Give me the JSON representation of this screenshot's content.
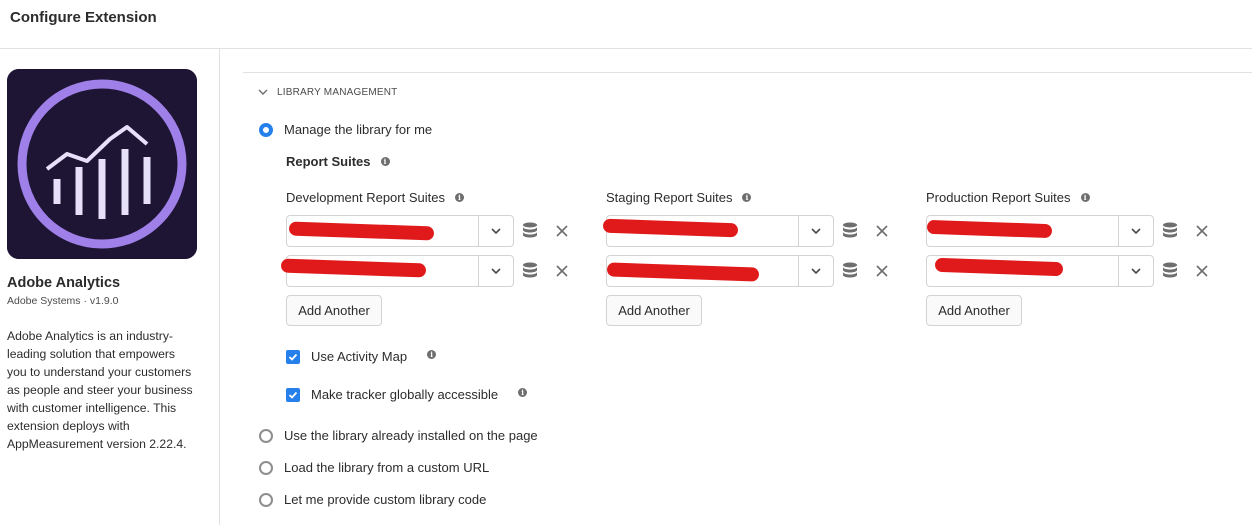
{
  "header": {
    "title": "Configure Extension"
  },
  "extension": {
    "name": "Adobe Analytics",
    "meta": "Adobe Systems · v1.9.0",
    "description": "Adobe Analytics is an industry-leading solution that empowers you to understand your customers as people and steer your business with customer intelligence. This extension deploys with AppMeasurement version 2.22.4.",
    "logo_icon": "adobe-analytics-logo",
    "logo_bg": "#1e1534",
    "logo_accent": "#9f7fe8"
  },
  "section": {
    "title": "LIBRARY MANAGEMENT",
    "expanded": true
  },
  "library_options": [
    {
      "label": "Manage the library for me",
      "checked": true
    },
    {
      "label": "Use the library already installed on the page",
      "checked": false
    },
    {
      "label": "Load the library from a custom URL",
      "checked": false
    },
    {
      "label": "Let me provide custom library code",
      "checked": false
    }
  ],
  "report_suites": {
    "label": "Report Suites",
    "columns": [
      {
        "label": "Development Report Suites",
        "values": [
          "",
          "",
          ""
        ],
        "add_label": "Add Another"
      },
      {
        "label": "Staging Report Suites",
        "values": [
          "",
          ""
        ],
        "add_label": "Add Another"
      },
      {
        "label": "Production Report Suites",
        "values": [
          "",
          ""
        ],
        "add_label": "Add Another"
      }
    ]
  },
  "options": {
    "activity_map": {
      "label": "Use Activity Map",
      "checked": true
    },
    "tracker_global": {
      "label": "Make tracker globally accessible",
      "checked": true
    }
  },
  "colors": {
    "accent": "#2680eb",
    "redaction": "#e01a1a",
    "border": "#d3d3d3"
  },
  "icons": {
    "info": "info-icon",
    "dropdown": "chevron-down-icon",
    "data_element": "database-icon",
    "remove": "close-icon",
    "section_toggle": "chevron-down-icon"
  }
}
